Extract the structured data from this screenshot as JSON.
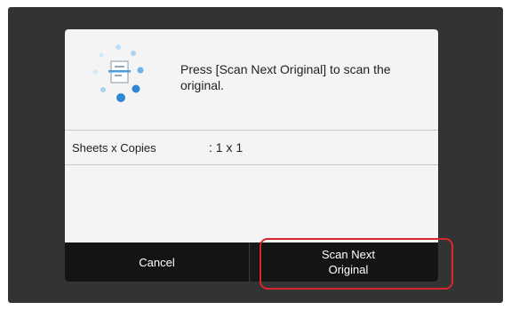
{
  "dialog": {
    "icon": "scanning-document-icon",
    "message": "Press [Scan Next Original] to scan the original.",
    "info": {
      "label": "Sheets x Copies",
      "value": ": 1 x 1"
    }
  },
  "buttons": {
    "cancel_label": "Cancel",
    "scan_next_label": "Scan Next\nOriginal"
  },
  "colors": {
    "screen_background": "#333333",
    "dialog_background": "#f4f4f4",
    "button_background": "#141414",
    "highlight_border": "#d9262c",
    "icon_dot_light": "#a9d4ef",
    "icon_dot_dark": "#2f86d4"
  }
}
